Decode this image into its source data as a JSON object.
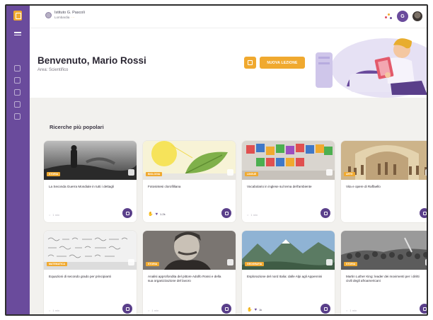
{
  "topbar": {
    "school_name": "Istituto G. Pascoli",
    "school_sub": "Lombardia",
    "school_tag": "· ··",
    "avatar_initial": "G"
  },
  "sidebar": {
    "items": [
      {
        "icon": "home-icon"
      },
      {
        "icon": "search-icon"
      },
      {
        "icon": "book-icon"
      },
      {
        "icon": "chart-icon"
      },
      {
        "icon": "folder-icon"
      }
    ]
  },
  "hero": {
    "welcome": "Benvenuto, Mario Rossi",
    "area": "Area: Scientifico",
    "cta_label": "NUOVA LEZIONE"
  },
  "section": {
    "title": "Ricerche più popolari"
  },
  "cards": [
    {
      "title": "La Seconda Guerra Mondiale in tutti i dettagli",
      "badge": "STORIA",
      "meta": "1 min"
    },
    {
      "title": "Fotosintesi clorofilliana",
      "badge": "BIOLOGIA",
      "meta": "1.2k"
    },
    {
      "title": "Vocabolario in inglese sul tema dell'ambiente",
      "badge": "LINGUE",
      "meta": "1 min"
    },
    {
      "title": "Vita e opere di Raffaello",
      "badge": "ARTE",
      "meta": ""
    },
    {
      "title": "Equazioni di secondo grado per principianti",
      "badge": "MATEMATICA",
      "meta": "1 min"
    },
    {
      "title": "Analisi approfondita del pittore Adolfo Rossi e della sua organizzazione del lavoro",
      "badge": "STORIA",
      "meta": "1 min"
    },
    {
      "title": "Esplorazione del nord Italia: dalle Alpi agli Appennini",
      "badge": "GEOGRAFIA",
      "meta": "1k"
    },
    {
      "title": "Martin Luther King: leader dei movimenti per i diritti civili degli afroamericani",
      "badge": "STORIA",
      "meta": "1 min"
    }
  ],
  "colors": {
    "sidebar": "#6a4b9c",
    "accent": "#f0a92f",
    "card_button": "#5a3f8a",
    "section_bg": "#f2f1ee"
  }
}
